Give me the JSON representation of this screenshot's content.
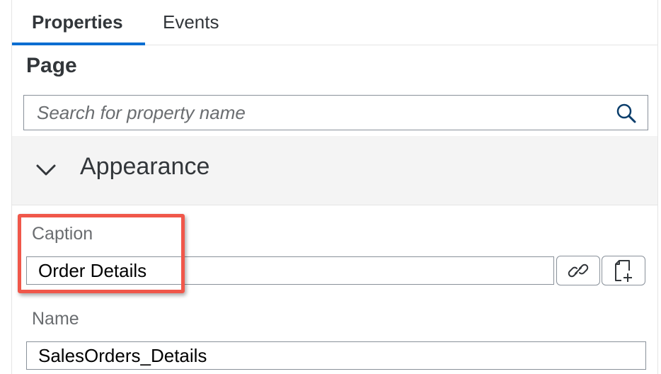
{
  "tabs": [
    {
      "label": "Properties",
      "active": true
    },
    {
      "label": "Events",
      "active": false
    }
  ],
  "page_title": "Page",
  "search": {
    "placeholder": "Search for property name",
    "value": "",
    "icon": "search-icon"
  },
  "section": {
    "label": "Appearance",
    "expanded": true,
    "icon": "chevron-down-icon"
  },
  "fields": {
    "caption": {
      "label": "Caption",
      "value": "Order Details",
      "actions": [
        "link-icon",
        "new-document-icon"
      ]
    },
    "name": {
      "label": "Name",
      "value": "SalesOrders_Details"
    }
  },
  "colors": {
    "accent": "#0a6ed1",
    "highlight": "#f0574a"
  }
}
